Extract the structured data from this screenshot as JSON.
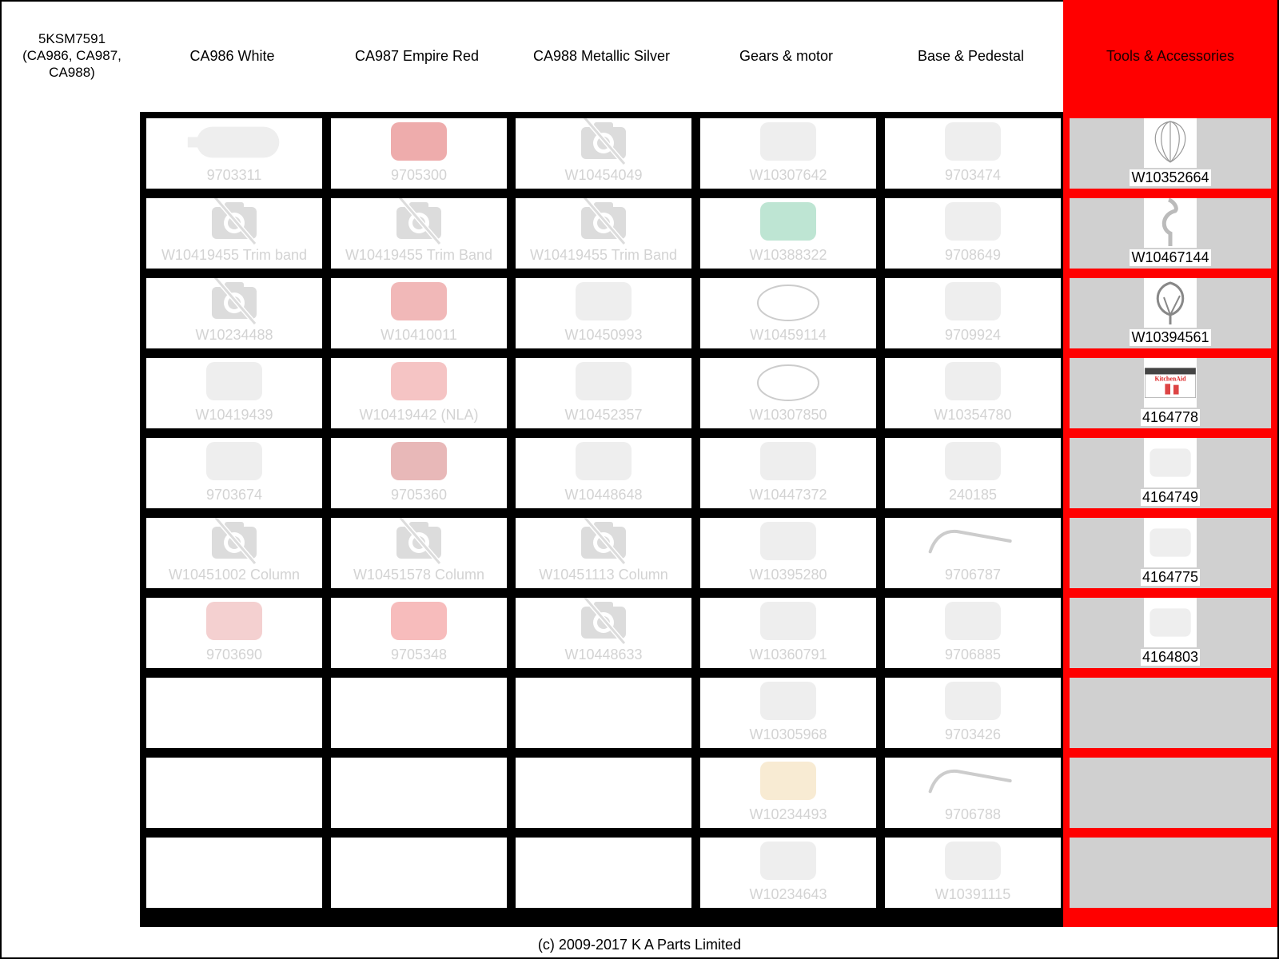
{
  "model": {
    "title_line1": "5KSM7591",
    "title_line2": "(CA986, CA987,",
    "title_line3": "CA988)"
  },
  "columns": [
    {
      "label": "CA986 White"
    },
    {
      "label": "CA987 Empire Red"
    },
    {
      "label": "CA988 Metallic Silver"
    },
    {
      "label": "Gears & motor"
    },
    {
      "label": "Base & Pedestal"
    },
    {
      "label": "Tools & Accessories"
    }
  ],
  "colors": {
    "tools_accent": "#ff0000",
    "tools_cell_bg": "#d0d0d0",
    "faded_label": "#d3d3d3",
    "grid_border": "#000000"
  },
  "parts": {
    "ca986_white": [
      {
        "label": "9703311",
        "icon": "bottle-shape"
      },
      {
        "label": "W10419455 Trim band",
        "icon": "no-image"
      },
      {
        "label": "W10234488",
        "icon": "no-image"
      },
      {
        "label": "W10419439",
        "icon": "bowl-clamp"
      },
      {
        "label": "9703674",
        "icon": "arc-bracket"
      },
      {
        "label": "W10451002 Column",
        "icon": "no-image"
      },
      {
        "label": "9703690",
        "icon": "parts-table"
      },
      null,
      null,
      null
    ],
    "ca987_red": [
      {
        "label": "9705300",
        "icon": "red-cover"
      },
      {
        "label": "W10419455 Trim Band",
        "icon": "no-image"
      },
      {
        "label": "W10410011",
        "icon": "red-plate"
      },
      {
        "label": "W10419442 (NLA)",
        "icon": "bowl-clamp-red"
      },
      {
        "label": "9705360",
        "icon": "red-arc-bracket"
      },
      {
        "label": "W10451578 Column",
        "icon": "no-image"
      },
      {
        "label": "9705348",
        "icon": "red-base"
      },
      null,
      null,
      null
    ],
    "ca988_silver": [
      {
        "label": "W10454049",
        "icon": "no-image"
      },
      {
        "label": "W10419455 Trim Band",
        "icon": "no-image"
      },
      {
        "label": "W10450993",
        "icon": "silver-plate"
      },
      {
        "label": "W10452357",
        "icon": "bowl-clamp-silver"
      },
      {
        "label": "W10448648",
        "icon": "silver-arc-bracket"
      },
      {
        "label": "W10451113 Column",
        "icon": "no-image"
      },
      {
        "label": "W10448633",
        "icon": "no-image"
      },
      null,
      null,
      null
    ],
    "gears_motor": [
      {
        "label": "W10307642",
        "icon": "motor"
      },
      {
        "label": "W10388322",
        "icon": "circuit-board"
      },
      {
        "label": "W10459114",
        "icon": "wire"
      },
      {
        "label": "W10307850",
        "icon": "power-cord"
      },
      {
        "label": "W10447372",
        "icon": "switch-wire"
      },
      {
        "label": "W10395280",
        "icon": "speed-knob"
      },
      {
        "label": "W10360791",
        "icon": "knob"
      },
      {
        "label": "W10305968",
        "icon": "lever"
      },
      {
        "label": "W10234493",
        "icon": "gear"
      },
      {
        "label": "W10234643",
        "icon": "small-gear"
      }
    ],
    "base_pedestal": [
      {
        "label": "9703474",
        "icon": "bracket-plate"
      },
      {
        "label": "9708649",
        "icon": "foot"
      },
      {
        "label": "9709924",
        "icon": "clear-part"
      },
      {
        "label": "W10354780",
        "icon": "bowl"
      },
      {
        "label": "240185",
        "icon": "pin"
      },
      {
        "label": "9706787",
        "icon": "lift-arm"
      },
      {
        "label": "9706885",
        "icon": "t-bracket"
      },
      {
        "label": "9703426",
        "icon": "screw-cap"
      },
      {
        "label": "9706788",
        "icon": "rod"
      },
      {
        "label": "W10391115",
        "icon": "cylinder"
      }
    ],
    "tools_accessories": [
      {
        "label": "W10352664",
        "icon": "whisk"
      },
      {
        "label": "W10467144",
        "icon": "dough-hook"
      },
      {
        "label": "W10394561",
        "icon": "flat-beater"
      },
      {
        "label": "4164778",
        "icon": "kitchenaid-box"
      },
      {
        "label": "4164749",
        "icon": "food-grinder"
      },
      {
        "label": "4164775",
        "icon": "fruit-strainer"
      },
      {
        "label": "4164803",
        "icon": "sausage-stuffer"
      },
      null,
      null,
      null
    ]
  },
  "footer": {
    "copyright": "(c) 2009-2017 K A Parts Limited"
  }
}
